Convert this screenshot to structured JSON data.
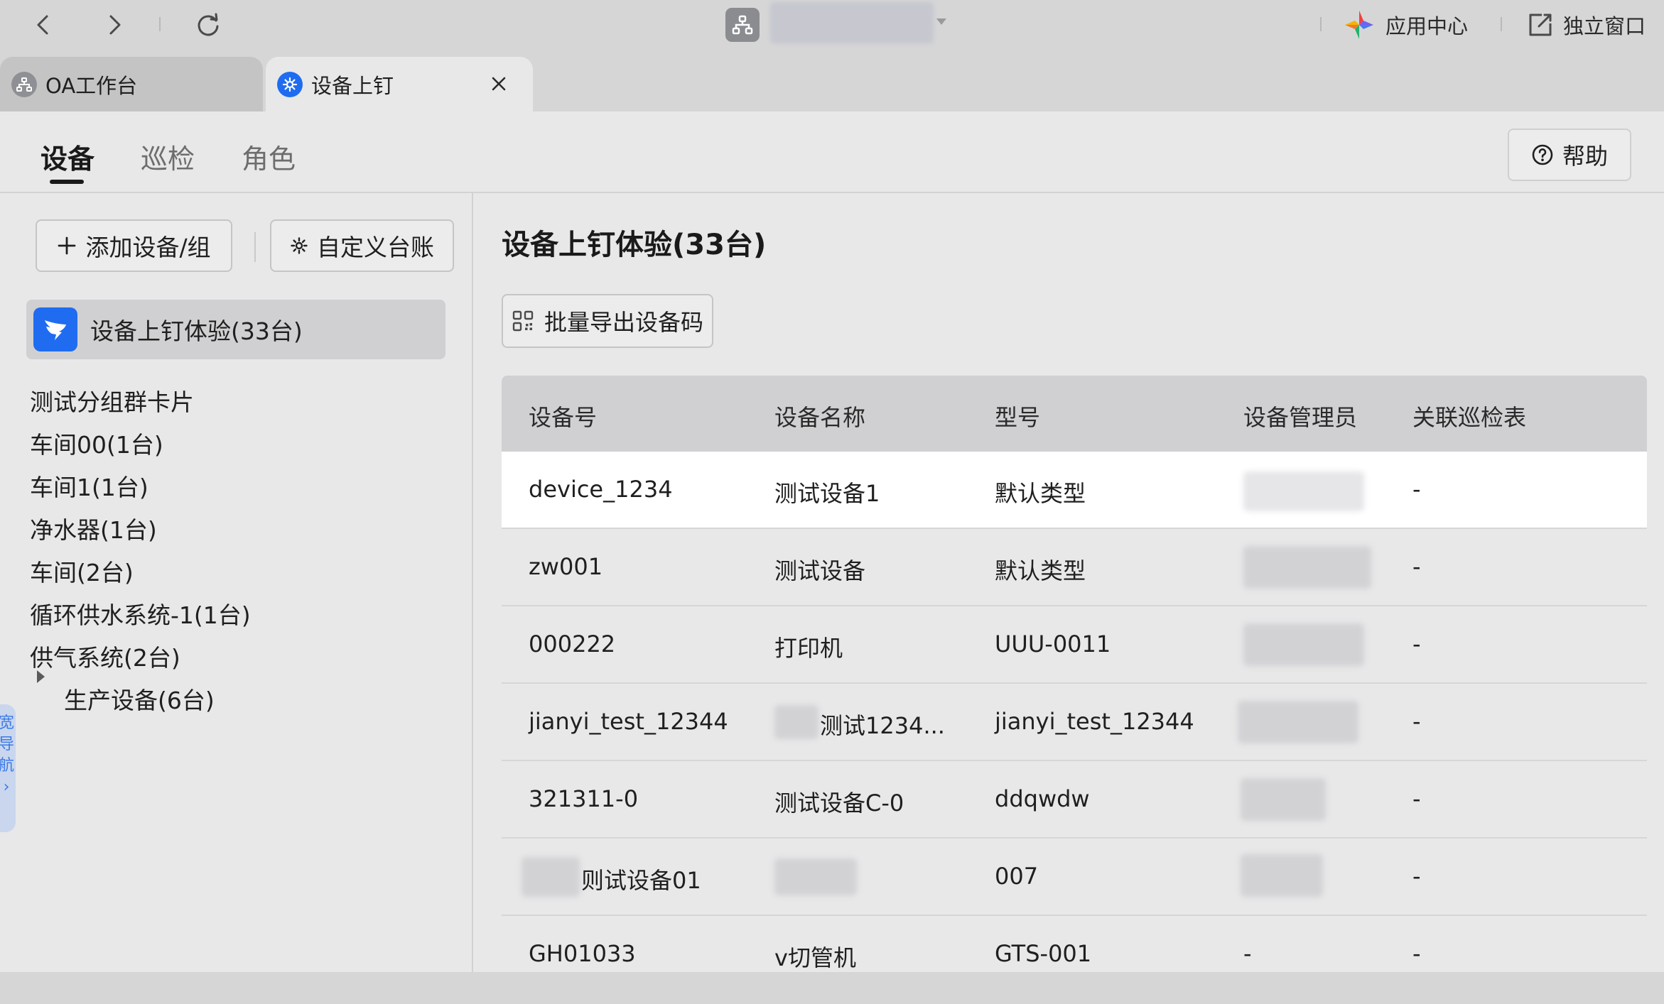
{
  "browser": {
    "app_center_label": "应用中心",
    "standalone_label": "独立窗口"
  },
  "tabs": [
    {
      "label": "OA工作台"
    },
    {
      "label": "设备上钉"
    }
  ],
  "subnav": {
    "tabs": [
      {
        "label": "设备"
      },
      {
        "label": "巡检"
      },
      {
        "label": "角色"
      }
    ],
    "help_label": "帮助"
  },
  "sidebar": {
    "add_button_label": "添加设备/组",
    "custom_ledger_label": "自定义台账",
    "selected_group": "设备上钉体验(33台)",
    "groups": [
      {
        "label": "测试分组群卡片"
      },
      {
        "label": "车间00(1台)"
      },
      {
        "label": "车间1(1台)"
      },
      {
        "label": "净水器(1台)"
      },
      {
        "label": "车间(2台)"
      },
      {
        "label": "循环供水系统-1(1台)"
      },
      {
        "label": "供气系统(2台)"
      },
      {
        "label": "生产设备(6台)"
      }
    ],
    "handle_text": [
      "宽",
      "导",
      "航",
      "›"
    ]
  },
  "main": {
    "title": "设备上钉体验(33台)",
    "export_label": "批量导出设备码",
    "columns": [
      "设备号",
      "设备名称",
      "型号",
      "设备管理员",
      "关联巡检表"
    ],
    "rows": [
      {
        "id": "device_1234",
        "name": "测试设备1",
        "model": "默认类型",
        "inspection": "-"
      },
      {
        "id": "zw001",
        "name": "测试设备",
        "model": "默认类型",
        "inspection": "-"
      },
      {
        "id": "000222",
        "name": "打印机",
        "model": "UUU-0011",
        "inspection": "-"
      },
      {
        "id": "jianyi_test_12344",
        "name": "测试1234...",
        "model": "jianyi_test_12344",
        "inspection": "-"
      },
      {
        "id": "321311-0",
        "name": "测试设备C-0",
        "model": "ddqwdw",
        "inspection": "-"
      },
      {
        "id": "则试设备01",
        "name": "",
        "model": "007",
        "inspection": "-"
      },
      {
        "id": "GH01033",
        "name": "v切管机",
        "model": "GTS-001",
        "admin": "-",
        "inspection": "-"
      }
    ]
  },
  "colors": {
    "accent_blue": "#1f6cf0",
    "page_bg": "#e8e8e9",
    "chrome_bg": "#d6d6d7"
  }
}
